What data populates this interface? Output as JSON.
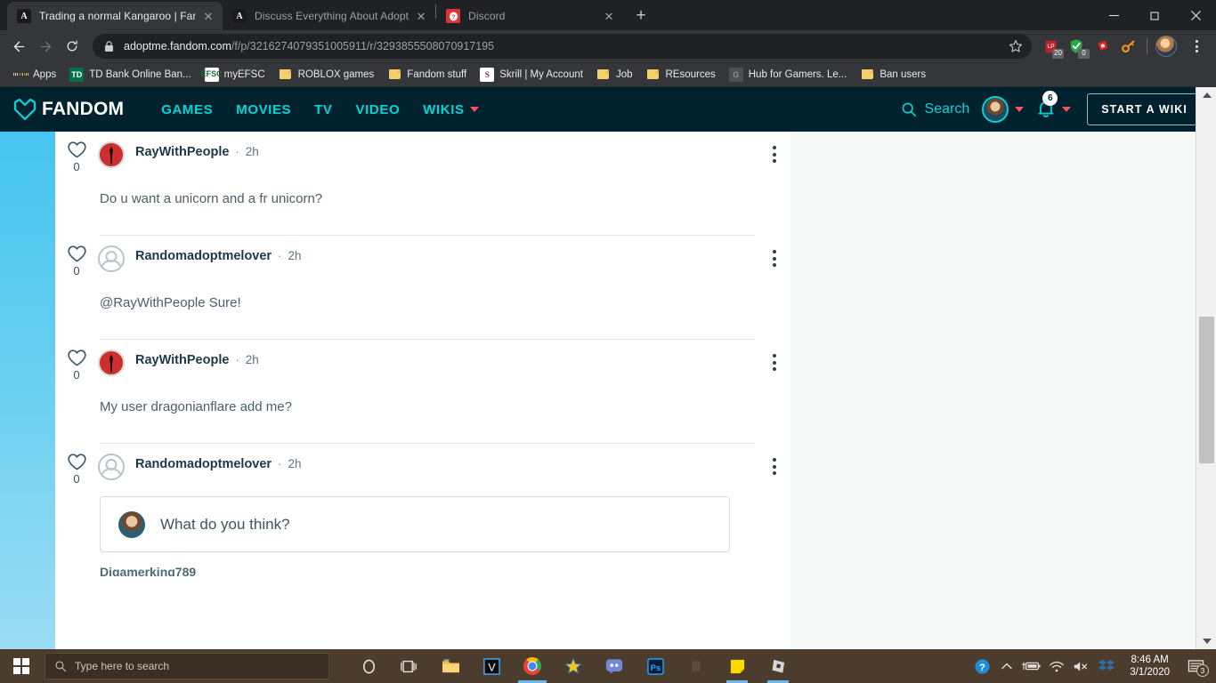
{
  "browser": {
    "tabs": [
      {
        "title": "Trading a normal Kangaroo | Fan",
        "favicon": "fandom-icon",
        "active": true,
        "close_label": "✕"
      },
      {
        "title": "Discuss Everything About Adopt",
        "favicon": "fandom-icon",
        "active": false,
        "close_label": "✕"
      },
      {
        "title": "Discord",
        "favicon": "discord-icon",
        "active": false,
        "close_label": "✕"
      }
    ],
    "new_tab_label": "+",
    "window_controls": {
      "minimize": "–",
      "maximize": "❐",
      "close": "✕"
    },
    "nav": {
      "back": "←",
      "forward": "→",
      "reload": "⟳"
    },
    "address": {
      "domain": "adoptme.fandom.com",
      "path": "/f/p/3216274079351005911/r/3293855508070917195"
    },
    "extensions": [
      {
        "name": "lastpass-extension",
        "badge": "20"
      },
      {
        "name": "shield-extension",
        "badge": "0"
      },
      {
        "name": "roblox-extension",
        "badge": ""
      },
      {
        "name": "key-extension",
        "badge": ""
      }
    ],
    "bookmarks": [
      {
        "label": "Apps",
        "icon": "apps-grid-icon"
      },
      {
        "label": "TD Bank Online Ban...",
        "icon": "td-icon"
      },
      {
        "label": "myEFSC",
        "icon": "efsc-icon"
      },
      {
        "label": "ROBLOX games",
        "icon": "folder-icon"
      },
      {
        "label": "Fandom stuff",
        "icon": "folder-icon"
      },
      {
        "label": "Skrill | My Account",
        "icon": "skrill-icon"
      },
      {
        "label": "Job",
        "icon": "folder-icon"
      },
      {
        "label": "REsources",
        "icon": "folder-icon"
      },
      {
        "label": "Hub for Gamers. Le...",
        "icon": "hub-icon"
      },
      {
        "label": "Ban users",
        "icon": "folder-icon"
      }
    ]
  },
  "fandom": {
    "logo_text": "FANDOM",
    "nav_links": [
      {
        "label": "GAMES",
        "has_caret": false
      },
      {
        "label": "MOVIES",
        "has_caret": false
      },
      {
        "label": "TV",
        "has_caret": false
      },
      {
        "label": "VIDEO",
        "has_caret": false
      },
      {
        "label": "WIKIS",
        "has_caret": true
      }
    ],
    "search_label": "Search",
    "notification_count": "6",
    "start_wiki_label": "START A WIKI"
  },
  "discussion": {
    "comments": [
      {
        "user": "RayWithPeople",
        "separator": "·",
        "time": "2h",
        "likes": "0",
        "avatar": "ray-avatar",
        "text": "Do u want a unicorn and a fr unicorn?"
      },
      {
        "user": "Randomadoptmelover",
        "separator": "·",
        "time": "2h",
        "likes": "0",
        "avatar": "default-avatar",
        "text": "@RayWithPeople Sure!"
      },
      {
        "user": "RayWithPeople",
        "separator": "·",
        "time": "2h",
        "likes": "0",
        "avatar": "ray-avatar",
        "text": "My user dragonianflare add me?"
      }
    ],
    "last_comment": {
      "user": "Randomadoptmelover",
      "separator": "·",
      "time": "2h",
      "likes": "0",
      "avatar": "default-avatar"
    },
    "reply_box": {
      "placeholder": "What do you think?"
    },
    "clipped_username": "Digamerking789"
  },
  "taskbar": {
    "search_placeholder": "Type here to search",
    "apps": [
      {
        "name": "cortana-icon"
      },
      {
        "name": "task-view-icon"
      },
      {
        "name": "file-explorer-icon"
      },
      {
        "name": "vegas-icon"
      },
      {
        "name": "chrome-icon"
      },
      {
        "name": "star-icon"
      },
      {
        "name": "discord-icon"
      },
      {
        "name": "photoshop-icon"
      },
      {
        "name": "dim-icon"
      },
      {
        "name": "sticky-notes-icon"
      },
      {
        "name": "roblox-icon"
      }
    ],
    "clock_time": "8:46 AM",
    "clock_date": "3/1/2020",
    "notification_count": "3"
  }
}
